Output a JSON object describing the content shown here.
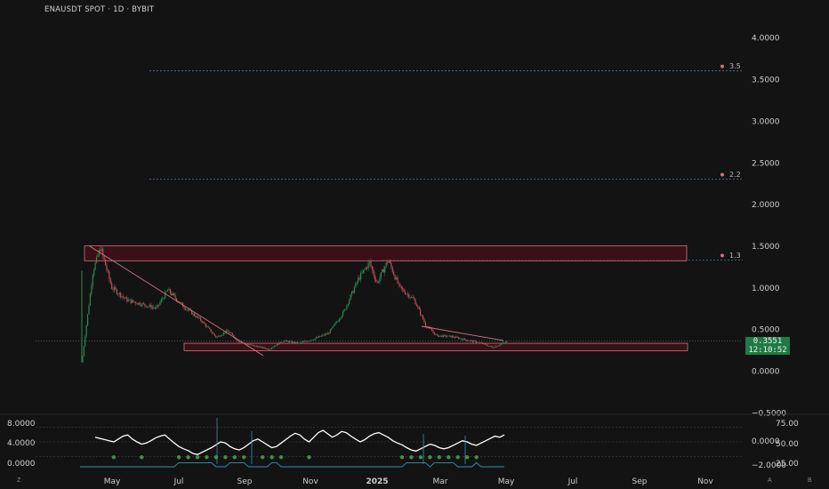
{
  "header": {
    "title": "ENAUSDT SPOT · 1D · BYBIT"
  },
  "price_tag": {
    "price": "0.3551",
    "countdown": "12:10:52"
  },
  "corners": {
    "left": "Z",
    "right_a": "A",
    "right_b": "B"
  },
  "colors": {
    "background": "#131313",
    "zone_fill": "#4a0f1a",
    "zone_stroke": "#d2707e",
    "trendline": "#d07a8a",
    "level_line": "#4a7aa6",
    "current_price": "#1f7a45",
    "candle_up": "#2e8b57",
    "candle_down": "#c0505a",
    "oscillator": "#ffffff",
    "dots": "#4caf50",
    "signal": "#3a8fb0"
  },
  "chart_data": [
    {
      "type": "candlestick",
      "symbol": "ENAUSDT",
      "timeframe": "1D",
      "exchange": "BYBIT",
      "y_ticks": [
        4.0,
        3.5,
        3.0,
        2.5,
        2.0,
        1.5,
        1.0,
        0.5,
        0.0,
        -0.5
      ],
      "ylim": [
        -0.5,
        4.0
      ],
      "x_ticks": [
        "May",
        "Jul",
        "Sep",
        "Nov",
        "2025",
        "Mar",
        "May",
        "Jul",
        "Sep",
        "Nov"
      ],
      "current_price": 0.3551,
      "levels": [
        {
          "label": "3.5",
          "value": 3.6
        },
        {
          "label": "2.2",
          "value": 2.3
        },
        {
          "label": "1.3",
          "value": 1.33
        }
      ],
      "zones": [
        {
          "name": "resistance",
          "y_low": 1.32,
          "y_high": 1.5
        },
        {
          "name": "support",
          "y_low": 0.24,
          "y_high": 0.33
        }
      ],
      "price_path": [
        {
          "x": 0.0,
          "y": 0.1
        },
        {
          "x": 0.3,
          "y": 1.2
        },
        {
          "x": 0.5,
          "y": 1.48
        },
        {
          "x": 0.8,
          "y": 1.0
        },
        {
          "x": 1.2,
          "y": 0.85
        },
        {
          "x": 1.6,
          "y": 0.8
        },
        {
          "x": 2.0,
          "y": 0.75
        },
        {
          "x": 2.3,
          "y": 0.97
        },
        {
          "x": 2.7,
          "y": 0.78
        },
        {
          "x": 3.2,
          "y": 0.6
        },
        {
          "x": 3.6,
          "y": 0.4
        },
        {
          "x": 3.9,
          "y": 0.48
        },
        {
          "x": 4.2,
          "y": 0.35
        },
        {
          "x": 4.6,
          "y": 0.3
        },
        {
          "x": 5.0,
          "y": 0.26
        },
        {
          "x": 5.4,
          "y": 0.36
        },
        {
          "x": 5.8,
          "y": 0.33
        },
        {
          "x": 6.2,
          "y": 0.38
        },
        {
          "x": 6.6,
          "y": 0.45
        },
        {
          "x": 7.0,
          "y": 0.7
        },
        {
          "x": 7.4,
          "y": 1.1
        },
        {
          "x": 7.7,
          "y": 1.3
        },
        {
          "x": 7.9,
          "y": 1.05
        },
        {
          "x": 8.2,
          "y": 1.33
        },
        {
          "x": 8.5,
          "y": 1.0
        },
        {
          "x": 8.9,
          "y": 0.85
        },
        {
          "x": 9.2,
          "y": 0.55
        },
        {
          "x": 9.5,
          "y": 0.42
        },
        {
          "x": 9.9,
          "y": 0.41
        },
        {
          "x": 10.3,
          "y": 0.37
        },
        {
          "x": 10.7,
          "y": 0.33
        },
        {
          "x": 11.0,
          "y": 0.28
        },
        {
          "x": 11.4,
          "y": 0.355
        }
      ]
    },
    {
      "type": "line",
      "name": "oscillator",
      "left_ticks": [
        8.0,
        4.0,
        0.0
      ],
      "right_ticks": [
        75.0,
        0.0,
        50.0,
        -2.0,
        25.0
      ],
      "right_tick_labels": [
        "75.00",
        "0.0000",
        "50.00",
        "−2.0000",
        "25.00"
      ],
      "left_tick_labels": [
        "8.0000",
        "4.0000",
        "0.0000"
      ],
      "ylim": [
        10,
        90
      ],
      "series_values": [
        58,
        56,
        54,
        52,
        50,
        55,
        60,
        62,
        55,
        50,
        46,
        48,
        52,
        57,
        60,
        62,
        55,
        48,
        42,
        38,
        35,
        30,
        28,
        32,
        36,
        40,
        45,
        50,
        48,
        42,
        38,
        36,
        40,
        46,
        52,
        55,
        50,
        45,
        40,
        42,
        48,
        54,
        60,
        65,
        62,
        55,
        50,
        58,
        66,
        70,
        64,
        58,
        62,
        68,
        66,
        60,
        55,
        50,
        54,
        60,
        64,
        66,
        62,
        58,
        52,
        48,
        45,
        40,
        36,
        34,
        38,
        42,
        46,
        44,
        40,
        38,
        40,
        44,
        48,
        52,
        50,
        46,
        44,
        48,
        52,
        56,
        60,
        58,
        62
      ]
    }
  ]
}
